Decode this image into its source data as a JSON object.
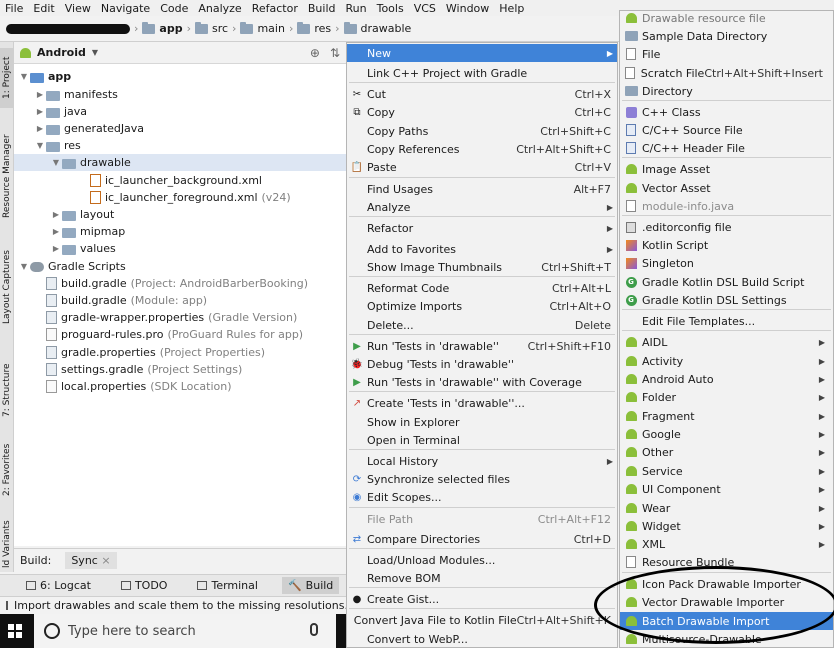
{
  "menubar": [
    "File",
    "Edit",
    "View",
    "Navigate",
    "Code",
    "Analyze",
    "Refactor",
    "Build",
    "Run",
    "Tools",
    "VCS",
    "Window",
    "Help"
  ],
  "breadcrumb": [
    "app",
    "src",
    "main",
    "res",
    "drawable"
  ],
  "left_tabs": [
    "1: Project",
    "Resource Manager",
    "Layout Captures",
    "7: Structure",
    "2: Favorites",
    "ld Variants"
  ],
  "project": {
    "view_label": "Android",
    "tree": [
      {
        "label": "app",
        "hint": ""
      },
      {
        "label": "manifests",
        "hint": ""
      },
      {
        "label": "java",
        "hint": ""
      },
      {
        "label": "generatedJava",
        "hint": ""
      },
      {
        "label": "res",
        "hint": ""
      },
      {
        "label": "drawable",
        "hint": ""
      },
      {
        "label": "ic_launcher_background.xml",
        "hint": ""
      },
      {
        "label": "ic_launcher_foreground.xml",
        "hint": "(v24)"
      },
      {
        "label": "layout",
        "hint": ""
      },
      {
        "label": "mipmap",
        "hint": ""
      },
      {
        "label": "values",
        "hint": ""
      },
      {
        "label": "Gradle Scripts",
        "hint": ""
      },
      {
        "label": "build.gradle",
        "hint": "(Project: AndroidBarberBooking)"
      },
      {
        "label": "build.gradle",
        "hint": "(Module: app)"
      },
      {
        "label": "gradle-wrapper.properties",
        "hint": "(Gradle Version)"
      },
      {
        "label": "proguard-rules.pro",
        "hint": "(ProGuard Rules for app)"
      },
      {
        "label": "gradle.properties",
        "hint": "(Project Properties)"
      },
      {
        "label": "settings.gradle",
        "hint": "(Project Settings)"
      },
      {
        "label": "local.properties",
        "hint": "(SDK Location)"
      }
    ]
  },
  "buildbar": {
    "label": "Build:",
    "sync": "Sync",
    "close": "×"
  },
  "tooltabs": [
    "6: Logcat",
    "TODO",
    "Terminal",
    "Build"
  ],
  "status": "Import drawables and scale them to the missing resolutions.",
  "taskbar": {
    "search_placeholder": "Type here to search"
  },
  "context_menu": [
    {
      "label": "New",
      "shortcut": "",
      "submenu": true,
      "highlighted": true
    },
    {
      "label": "Link C++ Project with Gradle",
      "shortcut": ""
    },
    {
      "label": "Cut",
      "shortcut": "Ctrl+X",
      "icon": "scissors-icon"
    },
    {
      "label": "Copy",
      "shortcut": "Ctrl+C",
      "icon": "copy-icon"
    },
    {
      "label": "Copy Paths",
      "shortcut": "Ctrl+Shift+C"
    },
    {
      "label": "Copy References",
      "shortcut": "Ctrl+Alt+Shift+C"
    },
    {
      "label": "Paste",
      "shortcut": "Ctrl+V",
      "icon": "paste-icon"
    },
    {
      "label": "Find Usages",
      "shortcut": "Alt+F7"
    },
    {
      "label": "Analyze",
      "shortcut": "",
      "submenu": true
    },
    {
      "label": "Refactor",
      "shortcut": "",
      "submenu": true
    },
    {
      "label": "Add to Favorites",
      "shortcut": "",
      "submenu": true
    },
    {
      "label": "Show Image Thumbnails",
      "shortcut": "Ctrl+Shift+T"
    },
    {
      "label": "Reformat Code",
      "shortcut": "Ctrl+Alt+L"
    },
    {
      "label": "Optimize Imports",
      "shortcut": "Ctrl+Alt+O"
    },
    {
      "label": "Delete...",
      "shortcut": "Delete"
    },
    {
      "label": "Run 'Tests in 'drawable''",
      "shortcut": "Ctrl+Shift+F10",
      "icon": "run-icon"
    },
    {
      "label": "Debug 'Tests in 'drawable''",
      "shortcut": "",
      "icon": "debug-icon"
    },
    {
      "label": "Run 'Tests in 'drawable'' with Coverage",
      "shortcut": "",
      "icon": "coverage-icon"
    },
    {
      "label": "Create 'Tests in 'drawable''...",
      "shortcut": "",
      "icon": "create-test-icon"
    },
    {
      "label": "Show in Explorer",
      "shortcut": ""
    },
    {
      "label": "Open in Terminal",
      "shortcut": ""
    },
    {
      "label": "Local History",
      "shortcut": "",
      "submenu": true
    },
    {
      "label": "Synchronize selected files",
      "shortcut": "",
      "icon": "sync-icon"
    },
    {
      "label": "Edit Scopes...",
      "shortcut": "",
      "icon": "scope-icon"
    },
    {
      "label": "File Path",
      "shortcut": "Ctrl+Alt+F12",
      "disabled": true
    },
    {
      "label": "Compare Directories",
      "shortcut": "Ctrl+D",
      "icon": "compare-icon"
    },
    {
      "label": "Load/Unload Modules...",
      "shortcut": ""
    },
    {
      "label": "Remove BOM",
      "shortcut": ""
    },
    {
      "label": "Create Gist...",
      "shortcut": "",
      "icon": "github-icon"
    },
    {
      "label": "Convert Java File to Kotlin File",
      "shortcut": "Ctrl+Alt+Shift+K"
    },
    {
      "label": "Convert to WebP...",
      "shortcut": ""
    }
  ],
  "new_submenu": [
    {
      "label": "Drawable resource file",
      "icon": "android-icon",
      "partial": true
    },
    {
      "label": "Sample Data Directory",
      "icon": "folder-icon"
    },
    {
      "label": "File",
      "icon": "file-icon"
    },
    {
      "label": "Scratch File",
      "shortcut": "Ctrl+Alt+Shift+Insert",
      "icon": "scratch-icon"
    },
    {
      "label": "Directory",
      "icon": "folder-icon"
    },
    {
      "label": "C++ Class",
      "icon": "class-icon"
    },
    {
      "label": "C/C++ Source File",
      "icon": "cpp-icon"
    },
    {
      "label": "C/C++ Header File",
      "icon": "cpp-icon"
    },
    {
      "label": "Image Asset",
      "icon": "android-icon"
    },
    {
      "label": "Vector Asset",
      "icon": "android-icon"
    },
    {
      "label": "module-info.java",
      "icon": "file-icon",
      "disabled": true
    },
    {
      "label": ".editorconfig file",
      "icon": "config-icon"
    },
    {
      "label": "Kotlin Script",
      "icon": "kotlin-icon"
    },
    {
      "label": "Singleton",
      "icon": "kotlin-icon"
    },
    {
      "label": "Gradle Kotlin DSL Build Script",
      "icon": "gradle-icon"
    },
    {
      "label": "Gradle Kotlin DSL Settings",
      "icon": "gradle-icon"
    },
    {
      "label": "Edit File Templates...",
      "icon": ""
    },
    {
      "label": "AIDL",
      "icon": "android-icon",
      "submenu": true
    },
    {
      "label": "Activity",
      "icon": "android-icon",
      "submenu": true
    },
    {
      "label": "Android Auto",
      "icon": "android-icon",
      "submenu": true
    },
    {
      "label": "Folder",
      "icon": "android-icon",
      "submenu": true
    },
    {
      "label": "Fragment",
      "icon": "android-icon",
      "submenu": true
    },
    {
      "label": "Google",
      "icon": "android-icon",
      "submenu": true
    },
    {
      "label": "Other",
      "icon": "android-icon",
      "submenu": true
    },
    {
      "label": "Service",
      "icon": "android-icon",
      "submenu": true
    },
    {
      "label": "UI Component",
      "icon": "android-icon",
      "submenu": true
    },
    {
      "label": "Wear",
      "icon": "android-icon",
      "submenu": true
    },
    {
      "label": "Widget",
      "icon": "android-icon",
      "submenu": true
    },
    {
      "label": "XML",
      "icon": "android-icon",
      "submenu": true
    },
    {
      "label": "Resource Bundle",
      "icon": "file-icon"
    },
    {
      "label": "Icon Pack Drawable Importer",
      "icon": "android-icon"
    },
    {
      "label": "Vector Drawable Importer",
      "icon": "android-icon"
    },
    {
      "label": "Batch Drawable Import",
      "icon": "android-icon",
      "highlighted": true
    },
    {
      "label": "Multisource-Drawable",
      "icon": "android-icon"
    }
  ],
  "colors": {
    "highlight": "#3f83d8",
    "android_green": "#8bbf3a"
  }
}
